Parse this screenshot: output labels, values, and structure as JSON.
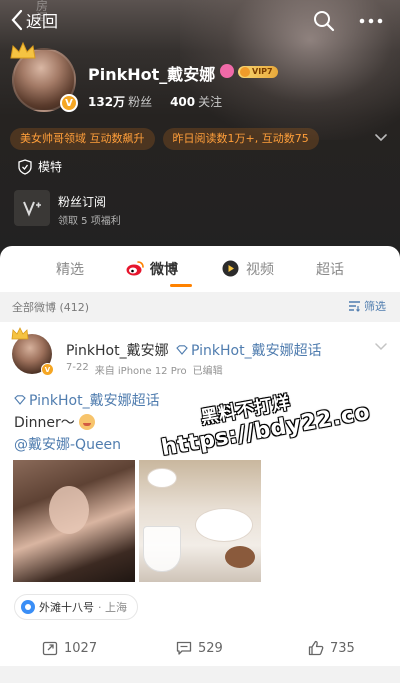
{
  "topbar": {
    "back_label": "返回",
    "ghost_text": "房间"
  },
  "profile": {
    "name": "PinkHot_戴安娜",
    "vip_label": "VIP7",
    "followers_count": "132万",
    "followers_label": "粉丝",
    "following_count": "400",
    "following_label": "关注",
    "tags": [
      "美女帅哥领域 互动数飙升",
      "昨日阅读数1万+, 互动数75"
    ],
    "title": "模特",
    "subscribe_title": "粉丝订阅",
    "subscribe_desc": "领取 5 项福利"
  },
  "tabs": [
    {
      "label": "精选",
      "active": false
    },
    {
      "label": "微博",
      "active": true
    },
    {
      "label": "视频",
      "active": false
    },
    {
      "label": "超话",
      "active": false
    }
  ],
  "filter": {
    "label": "全部微博 (412)",
    "button": "筛选"
  },
  "post": {
    "author": "PinkHot_戴安娜",
    "topic": "PinkHot_戴安娜超话",
    "date": "7-22",
    "source": "来自 iPhone 12 Pro",
    "edited": "已编辑",
    "topic_line": "PinkHot_戴安娜超话",
    "text": "Dinner～",
    "mention": "@戴安娜-Queen",
    "watermark_line1": "黑料不打烊",
    "watermark_line2": "https://bdy22.co",
    "location_name": "外滩十八号",
    "location_city": "· 上海",
    "reposts": "1027",
    "comments": "529",
    "likes": "735"
  },
  "colors": {
    "accent": "#ff8200",
    "link": "#507daf",
    "tag_text": "#ff9f3a"
  }
}
